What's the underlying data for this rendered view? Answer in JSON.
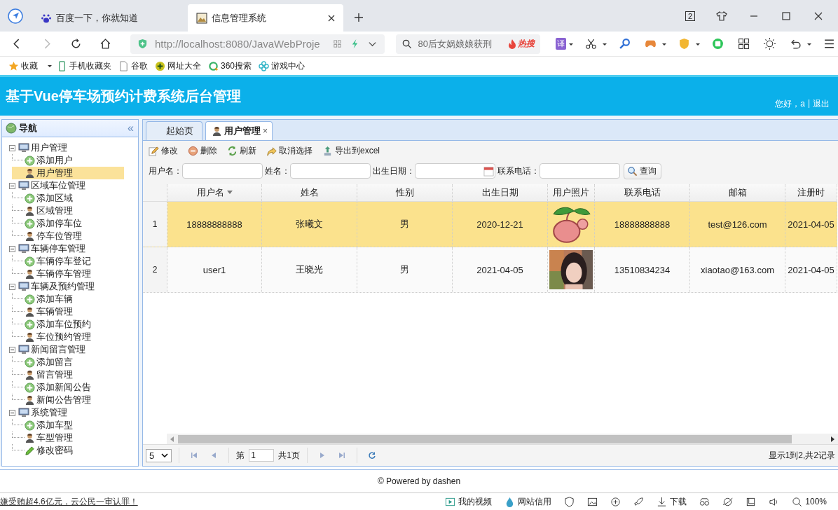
{
  "browser": {
    "tabs": [
      {
        "label": "百度一下，你就知道",
        "selected": false
      },
      {
        "label": "信息管理系统",
        "selected": true
      }
    ],
    "tab_count": "2",
    "address": "http://localhost:8080/JavaWebProje",
    "search": "80后女娲娘娘获刑",
    "hot": "热搜",
    "translate": "译",
    "bookmarks": [
      "收藏",
      "手机收藏夹",
      "谷歌",
      "网址大全",
      "360搜索",
      "游戏中心"
    ]
  },
  "app": {
    "title": "基于Vue停车场预约计费系统后台管理",
    "greeting": "您好，a",
    "separator": "|",
    "logout": "退出"
  },
  "nav": {
    "title": "导航",
    "collapse": "«",
    "tree": [
      {
        "label": "用户管理",
        "expanded": true,
        "children": [
          {
            "label": "添加用户",
            "kind": "add",
            "selected": false
          },
          {
            "label": "用户管理",
            "kind": "manage",
            "selected": true
          }
        ]
      },
      {
        "label": "区域车位管理",
        "expanded": true,
        "children": [
          {
            "label": "添加区域",
            "kind": "add",
            "selected": false
          },
          {
            "label": "区域管理",
            "kind": "manage",
            "selected": false
          },
          {
            "label": "添加停车位",
            "kind": "add",
            "selected": false
          },
          {
            "label": "停车位管理",
            "kind": "manage",
            "selected": false
          }
        ]
      },
      {
        "label": "车辆停车管理",
        "expanded": true,
        "children": [
          {
            "label": "车辆停车登记",
            "kind": "add",
            "selected": false
          },
          {
            "label": "车辆停车管理",
            "kind": "manage",
            "selected": false
          }
        ]
      },
      {
        "label": "车辆及预约管理",
        "expanded": true,
        "children": [
          {
            "label": "添加车辆",
            "kind": "add",
            "selected": false
          },
          {
            "label": "车辆管理",
            "kind": "manage",
            "selected": false
          },
          {
            "label": "添加车位预约",
            "kind": "add",
            "selected": false
          },
          {
            "label": "车位预约管理",
            "kind": "manage",
            "selected": false
          }
        ]
      },
      {
        "label": "新闻留言管理",
        "expanded": true,
        "children": [
          {
            "label": "添加留言",
            "kind": "add",
            "selected": false
          },
          {
            "label": "留言管理",
            "kind": "manage",
            "selected": false
          },
          {
            "label": "添加新闻公告",
            "kind": "add",
            "selected": false
          },
          {
            "label": "新闻公告管理",
            "kind": "manage",
            "selected": false
          }
        ]
      },
      {
        "label": "系统管理",
        "expanded": true,
        "children": [
          {
            "label": "添加车型",
            "kind": "add",
            "selected": false
          },
          {
            "label": "车型管理",
            "kind": "manage",
            "selected": false
          },
          {
            "label": "修改密码",
            "kind": "edit",
            "selected": false
          }
        ]
      }
    ]
  },
  "content_tabs": [
    {
      "label": "起始页",
      "selected": false,
      "closable": false
    },
    {
      "label": "用户管理",
      "selected": true,
      "closable": true
    }
  ],
  "close_mark": "×",
  "toolbar": [
    {
      "label": "修改",
      "kind": "edit"
    },
    {
      "label": "删除",
      "kind": "delete"
    },
    {
      "label": "刷新",
      "kind": "refresh"
    },
    {
      "label": "取消选择",
      "kind": "undo"
    },
    {
      "label": "导出到excel",
      "kind": "export"
    }
  ],
  "filters": [
    {
      "label": "用户名：",
      "kind": "text"
    },
    {
      "label": "姓名：",
      "kind": "text"
    },
    {
      "label": "出生日期：",
      "kind": "date"
    },
    {
      "label": "联系电话：",
      "kind": "text"
    }
  ],
  "query_button": "查询",
  "table": {
    "columns": [
      {
        "label": "用户名",
        "sorted": true
      },
      {
        "label": "姓名",
        "sorted": false
      },
      {
        "label": "性别",
        "sorted": false
      },
      {
        "label": "出生日期",
        "sorted": false
      },
      {
        "label": "用户照片",
        "sorted": false
      },
      {
        "label": "联系电话",
        "sorted": false
      },
      {
        "label": "邮箱",
        "sorted": false
      },
      {
        "label": "注册时",
        "sorted": false
      }
    ],
    "rows": [
      {
        "number": "1",
        "selected": true,
        "cells": [
          "18888888888",
          "张曦文",
          "男",
          "2020-12-21",
          {
            "kind": "picture"
          },
          "18888888888",
          "test@126.com",
          "2021-04-05"
        ]
      },
      {
        "number": "2",
        "selected": false,
        "cells": [
          "user1",
          "王晓光",
          "男",
          "2021-04-05",
          {
            "kind": "picture"
          },
          "13510834234",
          "xiaotao@163.com",
          "2021-04-05"
        ]
      }
    ]
  },
  "pager": {
    "page_size": "5",
    "page_prefix": "第",
    "page": "1",
    "total": "共1页",
    "summary": "显示1到2,共2记录"
  },
  "footer": "© Powered by dashen",
  "status_bar": {
    "news": "嫌受贿超4.6亿元，云公民一审认罪！",
    "items": [
      "我的视频",
      "网站信用",
      "下载",
      "100%"
    ]
  }
}
